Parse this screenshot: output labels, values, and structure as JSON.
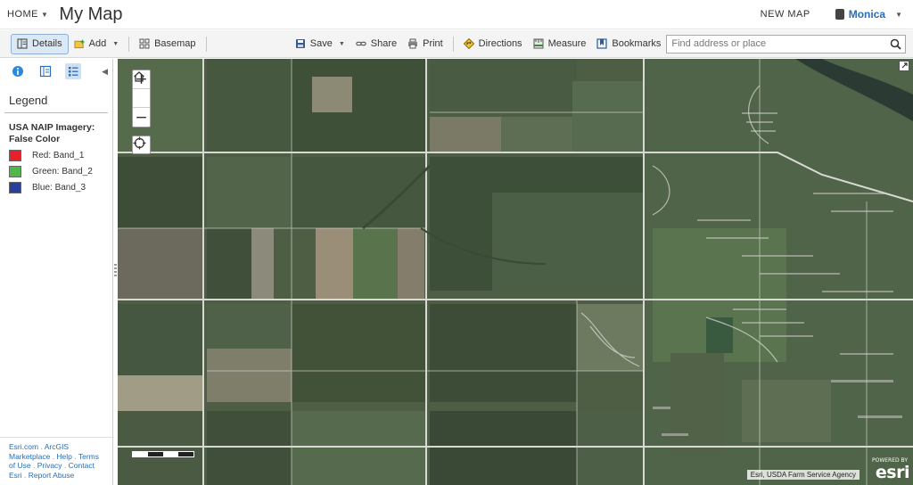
{
  "header": {
    "home_label": "HOME",
    "map_title": "My Map",
    "new_map_label": "NEW MAP",
    "user_name": "Monica"
  },
  "toolbar": {
    "details_label": "Details",
    "add_label": "Add",
    "basemap_label": "Basemap",
    "save_label": "Save",
    "share_label": "Share",
    "print_label": "Print",
    "directions_label": "Directions",
    "measure_label": "Measure",
    "bookmarks_label": "Bookmarks",
    "search_placeholder": "Find address or place"
  },
  "panel": {
    "tabs": [
      "about-icon",
      "content-icon",
      "legend-icon"
    ],
    "active_tab": "legend-icon",
    "legend_title": "Legend",
    "layer_name": "USA NAIP Imagery: False Color",
    "items": [
      {
        "label": "Red: Band_1",
        "color": "#e8202a"
      },
      {
        "label": "Green: Band_2",
        "color": "#4fb848"
      },
      {
        "label": "Blue: Band_3",
        "color": "#2a3f9c"
      }
    ],
    "footer": {
      "esri_com": "Esri.com",
      "marketplace": "ArcGIS Marketplace",
      "help": "Help",
      "terms": "Terms of Use",
      "privacy": "Privacy",
      "contact": "Contact Esri",
      "report": "Report Abuse"
    }
  },
  "map": {
    "zoom_in": "+",
    "zoom_out": "−",
    "attribution": "Esri, USDA Farm Service Agency",
    "logo_text": "esri",
    "logo_powered": "POWERED BY"
  },
  "colors": {
    "accent": "#2a6db8",
    "toolbar_bg": "#f4f4f4",
    "active_tab_bg": "#cfe0f3"
  }
}
